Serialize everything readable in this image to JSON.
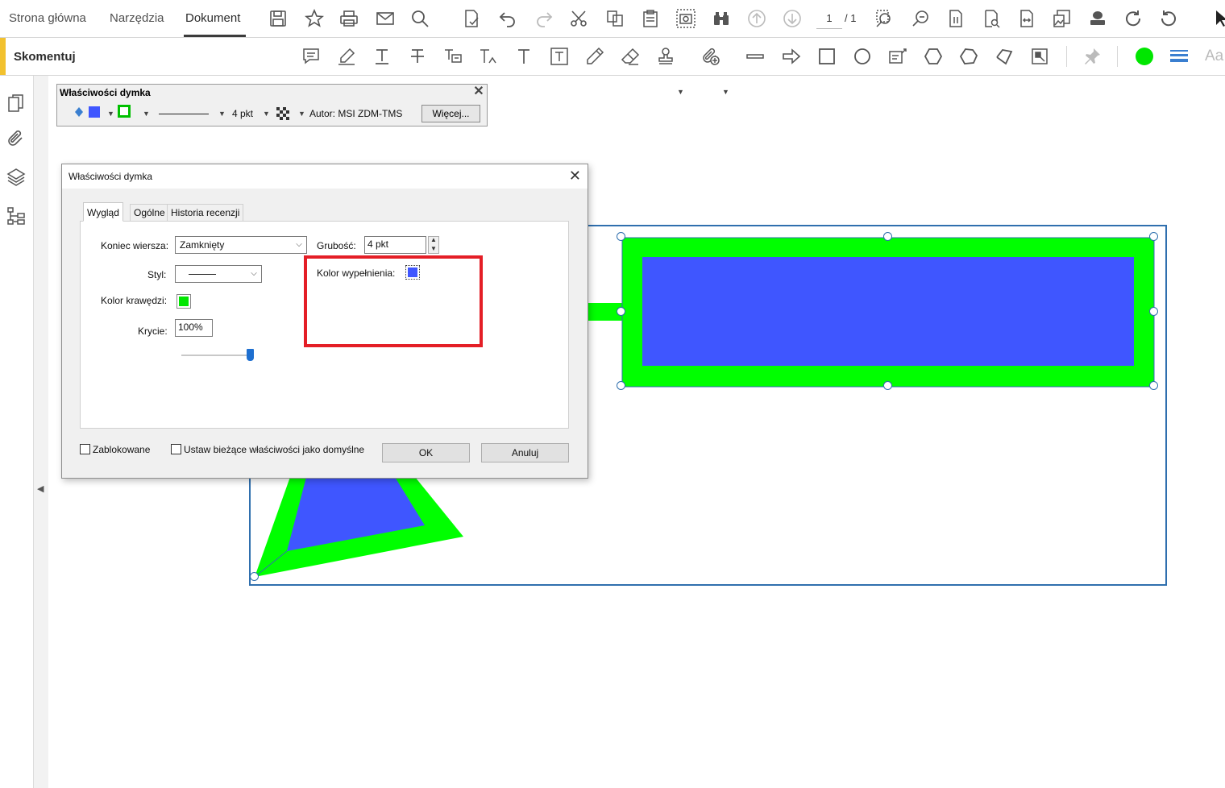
{
  "topbar": {
    "tabs": [
      {
        "label": "Strona główna"
      },
      {
        "label": "Narzędzia"
      },
      {
        "label": "Dokument"
      }
    ],
    "page_current": "1",
    "page_total": "/ 1"
  },
  "commentbar": {
    "title": "Skomentuj",
    "font_label": "Aa"
  },
  "propbar": {
    "title": "Właściwości dymka",
    "thickness": "4 pkt",
    "author": "Autor:  MSI ZDM-TMS",
    "more_button": "Więcej..."
  },
  "dialog": {
    "title": "Właściwości dymka",
    "tabs": [
      "Wygląd",
      "Ogólne",
      "Historia recenzji"
    ],
    "line_end_label": "Koniec wiersza:",
    "line_end_value": "Zamknięty",
    "thickness_label": "Grubość:",
    "thickness_value": "4 pkt",
    "style_label": "Styl:",
    "fill_color_label": "Kolor wypełnienia:",
    "border_color_label": "Kolor krawędzi:",
    "opacity_label": "Krycie:",
    "opacity_value": "100%",
    "opacity_level": 1.0,
    "locked_label": "Zablokowane",
    "default_label": "Ustaw bieżące właściwości jako domyślne",
    "ok_button": "OK",
    "cancel_button": "Anuluj"
  },
  "colors": {
    "fill": "#3f56ff",
    "border": "#00ff00",
    "highlight": "#e41e26",
    "selection": "#2f6fae"
  }
}
